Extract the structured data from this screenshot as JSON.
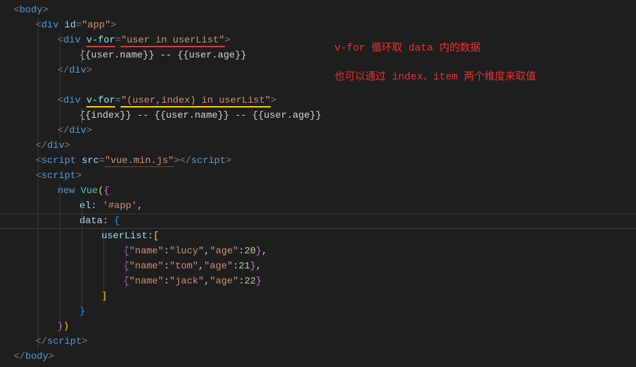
{
  "annot1": "v-for 循环取 data 内的数据",
  "annot2": "也可以通过 index、item 两个维度来取值",
  "l1": {
    "p1": "<",
    "p2": "body",
    "p3": ">"
  },
  "l2": {
    "p1": "<",
    "p2": "div ",
    "p3": "id",
    "p4": "=",
    "p5": "\"app\"",
    "p6": ">"
  },
  "l3": {
    "p1": "<",
    "p2": "div ",
    "p3": "v-for",
    "p4": "=",
    "p5": "\"user in userList\"",
    "p6": ">"
  },
  "l4": {
    "p1": "{{user.name}} -- {{user.age}}"
  },
  "l5": {
    "p1": "</",
    "p2": "div",
    "p3": ">"
  },
  "l6": {
    "p1": ""
  },
  "l7": {
    "p1": "<",
    "p2": "div ",
    "p3": "v-for",
    "p4": "=",
    "p5": "\"(user,index) in userList\"",
    "p6": ">"
  },
  "l8": {
    "p1": "{{index}} -- {{user.name}} -- {{user.age}}"
  },
  "l9": {
    "p1": "</",
    "p2": "div",
    "p3": ">"
  },
  "l10": {
    "p1": "</",
    "p2": "div",
    "p3": ">"
  },
  "l11": {
    "p1": "<",
    "p2": "script ",
    "p3": "src",
    "p4": "=",
    "p5": "\"vue.min.js\"",
    "p6": ">",
    "p7": "</",
    "p8": "script",
    "p9": ">"
  },
  "l12": {
    "p1": "<",
    "p2": "script",
    "p3": ">"
  },
  "l13": {
    "p1": "new ",
    "p2": "Vue",
    "p3": "(",
    "p4": "{"
  },
  "l14": {
    "p1": "el:",
    "p2": " '#app'",
    "p3": ","
  },
  "l15": {
    "p1": "data:",
    "p2": " ",
    "p3": "{"
  },
  "l16": {
    "p1": "userList:",
    "p2": "["
  },
  "l17": {
    "p1": "{",
    "p2": "\"name\"",
    "p3": ":",
    "p4": "\"lucy\"",
    "p5": ",",
    "p6": "\"age\"",
    "p7": ":",
    "p8": "20",
    "p9": "}",
    "p10": ","
  },
  "l18": {
    "p1": "{",
    "p2": "\"name\"",
    "p3": ":",
    "p4": "\"tom\"",
    "p5": ",",
    "p6": "\"age\"",
    "p7": ":",
    "p8": "21",
    "p9": "}",
    "p10": ","
  },
  "l19": {
    "p1": "{",
    "p2": "\"name\"",
    "p3": ":",
    "p4": "\"jack\"",
    "p5": ",",
    "p6": "\"age\"",
    "p7": ":",
    "p8": "22",
    "p9": "}"
  },
  "l20": {
    "p1": "]"
  },
  "l21": {
    "p1": "}"
  },
  "l22": {
    "p1": "}",
    "p2": ")"
  },
  "l23": {
    "p1": "</",
    "p2": "script",
    "p3": ">"
  },
  "l24": {
    "p1": "</",
    "p2": "body",
    "p3": ">"
  }
}
